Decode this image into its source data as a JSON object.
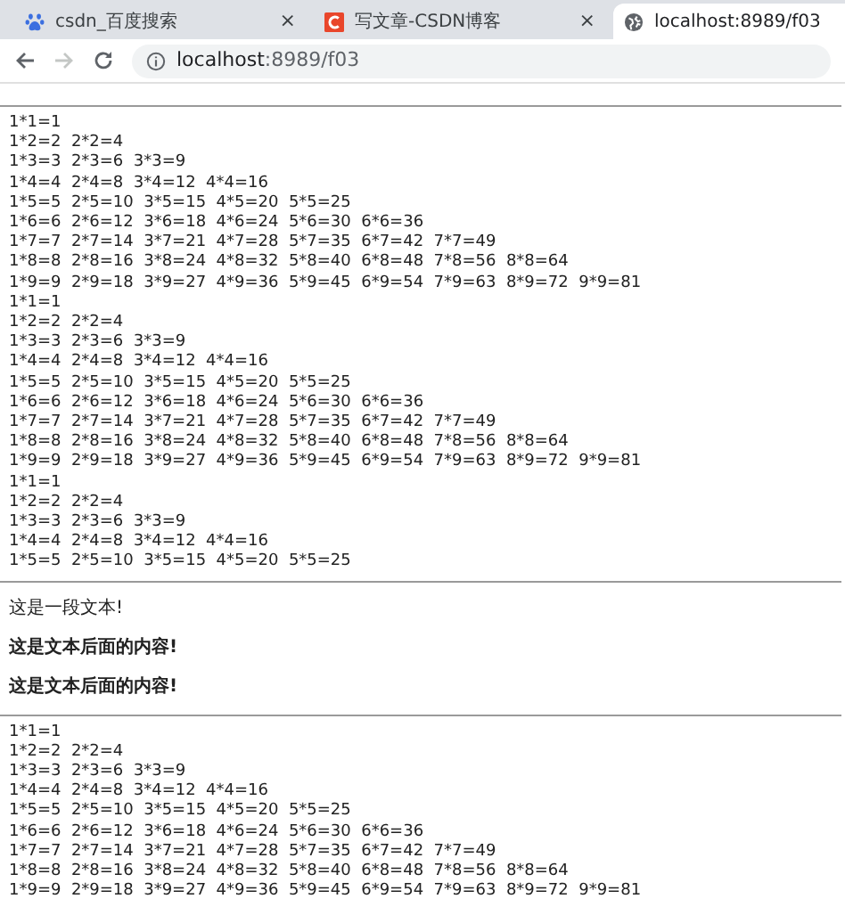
{
  "tabs": [
    {
      "title": "csdn_百度搜索",
      "close": "×",
      "selected": false
    },
    {
      "title": "写文章-CSDN博客",
      "close": "×",
      "selected": false
    },
    {
      "title": "localhost:8989/f03",
      "selected": true
    }
  ],
  "toolbar": {
    "back_enabled": true,
    "forward_enabled": false,
    "url_host": "localhost",
    "url_path": ":8989/f03"
  },
  "content": [
    {
      "kind": "rule"
    },
    {
      "kind": "table",
      "rows": [
        "1*1=1",
        "1*2=2  2*2=4",
        "1*3=3  2*3=6  3*3=9",
        "1*4=4  2*4=8  3*4=12  4*4=16",
        "1*5=5  2*5=10  3*5=15  4*5=20  5*5=25",
        "1*6=6  2*6=12  3*6=18  4*6=24  5*6=30  6*6=36",
        "1*7=7  2*7=14  3*7=21  4*7=28  5*7=35  6*7=42  7*7=49",
        "1*8=8  2*8=16  3*8=24  4*8=32  5*8=40  6*8=48  7*8=56  8*8=64",
        "1*9=9  2*9=18  3*9=27  4*9=36  5*9=45  6*9=54  7*9=63  8*9=72  9*9=81"
      ]
    },
    {
      "kind": "table",
      "rows": [
        "1*1=1",
        "1*2=2  2*2=4",
        "1*3=3  2*3=6  3*3=9",
        "1*4=4  2*4=8  3*4=12  4*4=16",
        "1*5=5  2*5=10  3*5=15  4*5=20  5*5=25",
        "1*6=6  2*6=12  3*6=18  4*6=24  5*6=30  6*6=36",
        "1*7=7  2*7=14  3*7=21  4*7=28  5*7=35  6*7=42  7*7=49",
        "1*8=8  2*8=16  3*8=24  4*8=32  5*8=40  6*8=48  7*8=56  8*8=64",
        "1*9=9  2*9=18  3*9=27  4*9=36  5*9=45  6*9=54  7*9=63  8*9=72  9*9=81"
      ]
    },
    {
      "kind": "table",
      "rows": [
        "1*1=1",
        "1*2=2  2*2=4",
        "1*3=3  2*3=6  3*3=9",
        "1*4=4  2*4=8  3*4=12  4*4=16",
        "1*5=5  2*5=10  3*5=15  4*5=20  5*5=25"
      ]
    },
    {
      "kind": "rule"
    },
    {
      "kind": "paragraph",
      "text": "这是一段文本!"
    },
    {
      "kind": "strong_paragraph",
      "text": "这是文本后面的内容!"
    },
    {
      "kind": "strong_paragraph",
      "text": "这是文本后面的内容!"
    },
    {
      "kind": "rule"
    },
    {
      "kind": "table",
      "rows": [
        "1*1=1",
        "1*2=2  2*2=4",
        "1*3=3  2*3=6  3*3=9",
        "1*4=4  2*4=8  3*4=12  4*4=16",
        "1*5=5  2*5=10  3*5=15  4*5=20  5*5=25",
        "1*6=6  2*6=12  3*6=18  4*6=24  5*6=30  6*6=36",
        "1*7=7  2*7=14  3*7=21  4*7=28  5*7=35  6*7=42  7*7=49",
        "1*8=8  2*8=16  3*8=24  4*8=32  5*8=40  6*8=48  7*8=56  8*8=64",
        "1*9=9  2*9=18  3*9=27  4*9=36  5*9=45  6*9=54  7*9=63  8*9=72  9*9=81"
      ]
    }
  ]
}
